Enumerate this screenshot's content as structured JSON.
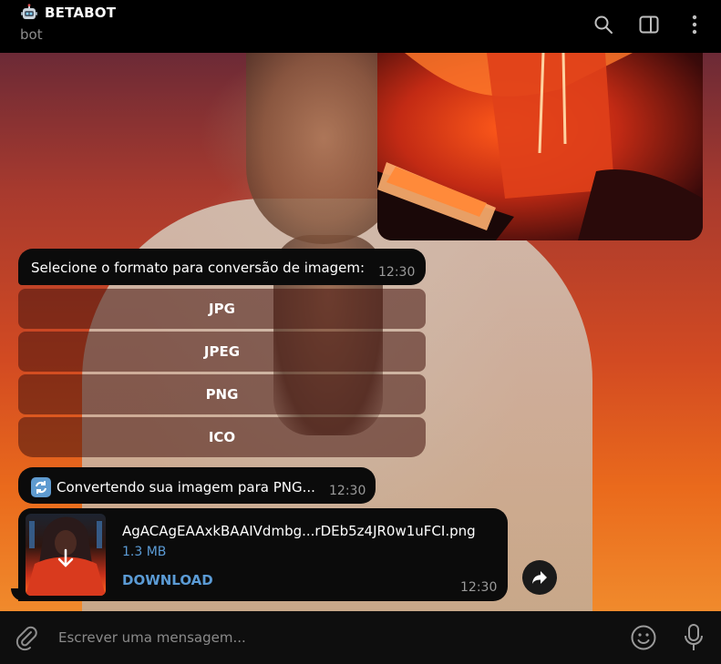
{
  "header": {
    "title": "BETABOT",
    "subtitle": "bot",
    "icons": [
      "robot-icon",
      "search-icon",
      "sidebar-toggle-icon",
      "more-vertical-icon"
    ]
  },
  "messages": {
    "select_format": {
      "text": "Selecione o formato para conversão de imagem:",
      "time": "12:30"
    },
    "keyboard_buttons": [
      "JPG",
      "JPEG",
      "PNG",
      "ICO"
    ],
    "converting": {
      "text": "Convertendo sua imagem para PNG...",
      "time": "12:30"
    },
    "file": {
      "name": "AgACAgEAAxkBAAIVdmbg...rDEb5z4JR0w1uFCI.png",
      "size": "1.3 MB",
      "action": "DOWNLOAD",
      "time": "12:30"
    }
  },
  "composer": {
    "placeholder": "Escrever uma mensagem..."
  },
  "colors": {
    "accent": "#5b9bd5",
    "bubble": "#0b0b0b",
    "header_bg": "#000000"
  }
}
